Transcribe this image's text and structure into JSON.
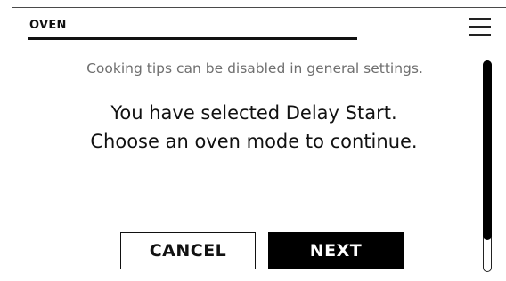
{
  "header": {
    "title": "OVEN",
    "menu_icon": "hamburger-menu-icon"
  },
  "content": {
    "tip": "Cooking tips can be disabled in general settings.",
    "message_line1": "You have selected Delay Start.",
    "message_line2": "Choose an oven mode to continue."
  },
  "actions": {
    "cancel_label": "CANCEL",
    "next_label": "NEXT"
  },
  "colors": {
    "primary": "#000000",
    "background": "#ffffff",
    "muted_text": "#6f6f6f"
  }
}
